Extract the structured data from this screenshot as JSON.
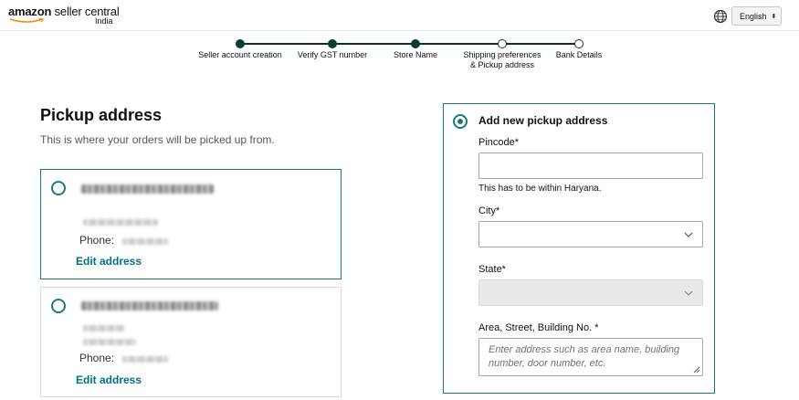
{
  "header": {
    "brand_prefix": "amazon",
    "brand_suffix": "seller central",
    "region": "India",
    "language_label": "English",
    "language_caret": "⬍"
  },
  "stepper": {
    "steps": [
      {
        "label": "Seller account creation",
        "status": "done"
      },
      {
        "label": "Verify GST number",
        "status": "done"
      },
      {
        "label": "Store Name",
        "status": "done"
      },
      {
        "label": "Shipping preferences",
        "label_line2": "& Pickup address",
        "status": "current"
      },
      {
        "label": "Bank Details",
        "status": "todo"
      }
    ]
  },
  "main": {
    "title": "Pickup address",
    "subtitle": "This is where your orders will be picked up from.",
    "addresses": [
      {
        "phone_label": "Phone:",
        "edit_label": "Edit address"
      },
      {
        "phone_label": "Phone:",
        "edit_label": "Edit address"
      }
    ]
  },
  "form": {
    "title": "Add new pickup address",
    "pincode_label": "Pincode*",
    "pincode_hint": "This has to be within Haryana.",
    "city_label": "City*",
    "state_label": "State*",
    "area_label": "Area, Street, Building No. *",
    "area_placeholder": "Enter address such as area name, building number, door number, etc."
  },
  "colors": {
    "accent": "#187a7a",
    "link": "#007185",
    "step_done": "#0a3b36"
  }
}
